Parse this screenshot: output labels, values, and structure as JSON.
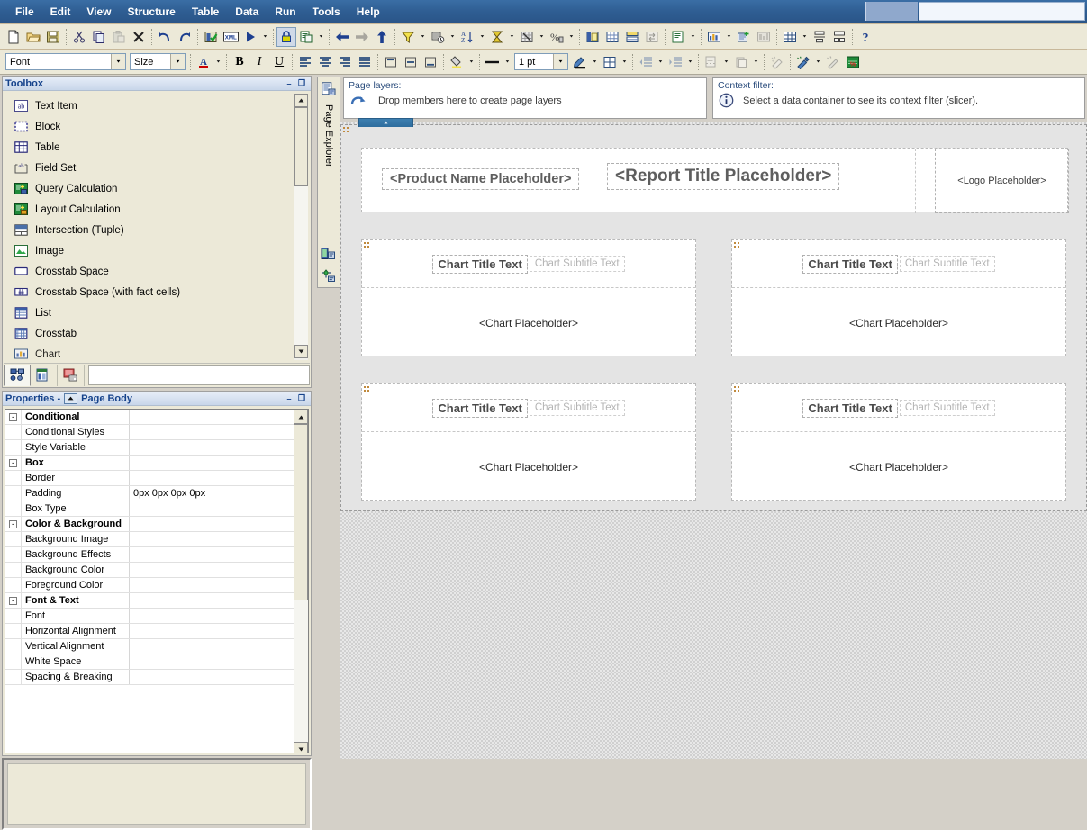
{
  "app": {
    "title_right_field": ""
  },
  "menubar": {
    "items": [
      {
        "label": "File",
        "name": "menu-file"
      },
      {
        "label": "Edit",
        "name": "menu-edit"
      },
      {
        "label": "View",
        "name": "menu-view"
      },
      {
        "label": "Structure",
        "name": "menu-structure"
      },
      {
        "label": "Table",
        "name": "menu-table"
      },
      {
        "label": "Data",
        "name": "menu-data"
      },
      {
        "label": "Run",
        "name": "menu-run"
      },
      {
        "label": "Tools",
        "name": "menu-tools"
      },
      {
        "label": "Help",
        "name": "menu-help"
      }
    ]
  },
  "toolbar_main": {
    "buttons": [
      "new-icon",
      "open-icon",
      "save-icon",
      "cut-icon",
      "copy-icon",
      "paste-icon",
      "delete-icon",
      "undo-icon",
      "redo-icon",
      "validate-report-icon",
      "xml-icon",
      "run-report-icon",
      "lock-icon",
      "page-structure-icon",
      "back-icon",
      "forward-icon",
      "up-icon",
      "filter-icon",
      "summarize-time-icon",
      "sort-icon",
      "aggregate-icon",
      "suppress-icon",
      "percent-icon",
      "group-icon",
      "pivot-icon",
      "section-icon",
      "swap-icon",
      "unlock-icon",
      "chart-icon",
      "insert-calc-icon",
      "chart-type-icon",
      "table-icon",
      "align-top-icon",
      "align-distribute-icon",
      "help-icon"
    ]
  },
  "toolbar_format": {
    "font": {
      "value": "Font",
      "placeholder": "Font"
    },
    "size": {
      "value": "Size",
      "placeholder": "Size"
    },
    "font_color": "font-color-icon",
    "bold": "B",
    "italic": "I",
    "underline": "U",
    "line_weight": {
      "value": "1 pt"
    },
    "buttons": [
      "align-left-icon",
      "align-center-icon",
      "align-right-icon",
      "align-justify-icon",
      "valign-top-icon",
      "valign-middle-icon",
      "valign-bottom-icon",
      "background-color-icon",
      "border-style-icon",
      "border-color-icon",
      "borders-icon",
      "indent-decrease-icon",
      "indent-increase-icon",
      "page-break-icon",
      "copy-format-icon",
      "clear-format-icon",
      "style-picker-icon",
      "clear-style-icon",
      "conditional-style-icon"
    ]
  },
  "toolbox": {
    "title": "Toolbox",
    "minimize_label": "–",
    "maximize_label": "❐",
    "items": [
      {
        "label": "Text Item",
        "icon": "text-item-icon"
      },
      {
        "label": "Block",
        "icon": "block-icon"
      },
      {
        "label": "Table",
        "icon": "table-icon"
      },
      {
        "label": "Field Set",
        "icon": "field-set-icon"
      },
      {
        "label": "Query Calculation",
        "icon": "query-calculation-icon"
      },
      {
        "label": "Layout Calculation",
        "icon": "layout-calculation-icon"
      },
      {
        "label": "Intersection (Tuple)",
        "icon": "intersection-tuple-icon"
      },
      {
        "label": "Image",
        "icon": "image-icon"
      },
      {
        "label": "Crosstab Space",
        "icon": "crosstab-space-icon"
      },
      {
        "label": "Crosstab Space (with fact cells)",
        "icon": "crosstab-space-fact-icon"
      },
      {
        "label": "List",
        "icon": "list-icon"
      },
      {
        "label": "Crosstab",
        "icon": "crosstab-icon"
      },
      {
        "label": "Chart",
        "icon": "chart-icon"
      }
    ],
    "tabs": [
      {
        "name": "insertable-objects-tab",
        "icon": "insertable-objects-icon",
        "selected": true
      },
      {
        "name": "toolbox-tab",
        "icon": "toolbox-tab-icon",
        "selected": false
      },
      {
        "name": "conditional-explorer-tab",
        "icon": "conditional-explorer-icon",
        "selected": false
      }
    ]
  },
  "properties": {
    "title_prefix": "Properties -",
    "title_object": "Page Body",
    "minimize_label": "–",
    "maximize_label": "❐",
    "rows": [
      {
        "group": true,
        "expander": "-",
        "name": "Conditional",
        "value": ""
      },
      {
        "group": false,
        "expander": "",
        "name": "Conditional Styles",
        "value": ""
      },
      {
        "group": false,
        "expander": "",
        "name": "Style Variable",
        "value": ""
      },
      {
        "group": true,
        "expander": "-",
        "name": "Box",
        "value": ""
      },
      {
        "group": false,
        "expander": "",
        "name": "Border",
        "value": ""
      },
      {
        "group": false,
        "expander": "",
        "name": "Padding",
        "value": "0px 0px 0px 0px"
      },
      {
        "group": false,
        "expander": "",
        "name": "Box Type",
        "value": ""
      },
      {
        "group": true,
        "expander": "-",
        "name": "Color & Background",
        "value": ""
      },
      {
        "group": false,
        "expander": "",
        "name": "Background Image",
        "value": ""
      },
      {
        "group": false,
        "expander": "",
        "name": "Background Effects",
        "value": ""
      },
      {
        "group": false,
        "expander": "",
        "name": "Background Color",
        "value": ""
      },
      {
        "group": false,
        "expander": "",
        "name": "Foreground Color",
        "value": ""
      },
      {
        "group": true,
        "expander": "-",
        "name": "Font & Text",
        "value": ""
      },
      {
        "group": false,
        "expander": "",
        "name": "Font",
        "value": ""
      },
      {
        "group": false,
        "expander": "",
        "name": "Horizontal Alignment",
        "value": ""
      },
      {
        "group": false,
        "expander": "",
        "name": "Vertical Alignment",
        "value": ""
      },
      {
        "group": false,
        "expander": "",
        "name": "White Space",
        "value": ""
      },
      {
        "group": false,
        "expander": "",
        "name": "Spacing & Breaking",
        "value": ""
      }
    ]
  },
  "explorer_bar": {
    "label": "Page Explorer",
    "top_icon": "page-explorer-icon",
    "bottom_icons": [
      "query-explorer-icon",
      "condition-explorer-icon"
    ]
  },
  "page_layers": {
    "heading": "Page layers:",
    "drop_text": "Drop members here to create page layers",
    "icon": "drop-arrow-icon"
  },
  "context_filter": {
    "heading": "Context filter:",
    "info_text": "Select a data container to see its context filter (slicer).",
    "icon": "info-icon"
  },
  "canvas": {
    "header": {
      "product_name": "<Product Name Placeholder>",
      "report_title": "<Report Title Placeholder>",
      "logo": "<Logo Placeholder>"
    },
    "charts": [
      {
        "title": "Chart Title Text",
        "subtitle": "Chart Subtitle Text",
        "placeholder": "<Chart Placeholder>"
      },
      {
        "title": "Chart Title Text",
        "subtitle": "Chart Subtitle Text",
        "placeholder": "<Chart Placeholder>"
      },
      {
        "title": "Chart Title Text",
        "subtitle": "Chart Subtitle Text",
        "placeholder": "<Chart Placeholder>"
      },
      {
        "title": "Chart Title Text",
        "subtitle": "Chart Subtitle Text",
        "placeholder": "<Chart Placeholder>"
      }
    ]
  },
  "colors": {
    "titlebar": "#2f5e93",
    "toolbar_bg": "#ece9d8",
    "panel_title_text": "#15428b",
    "canvas_bg": "#e8e8e8",
    "placeholder_text": "#5e5e5e"
  }
}
